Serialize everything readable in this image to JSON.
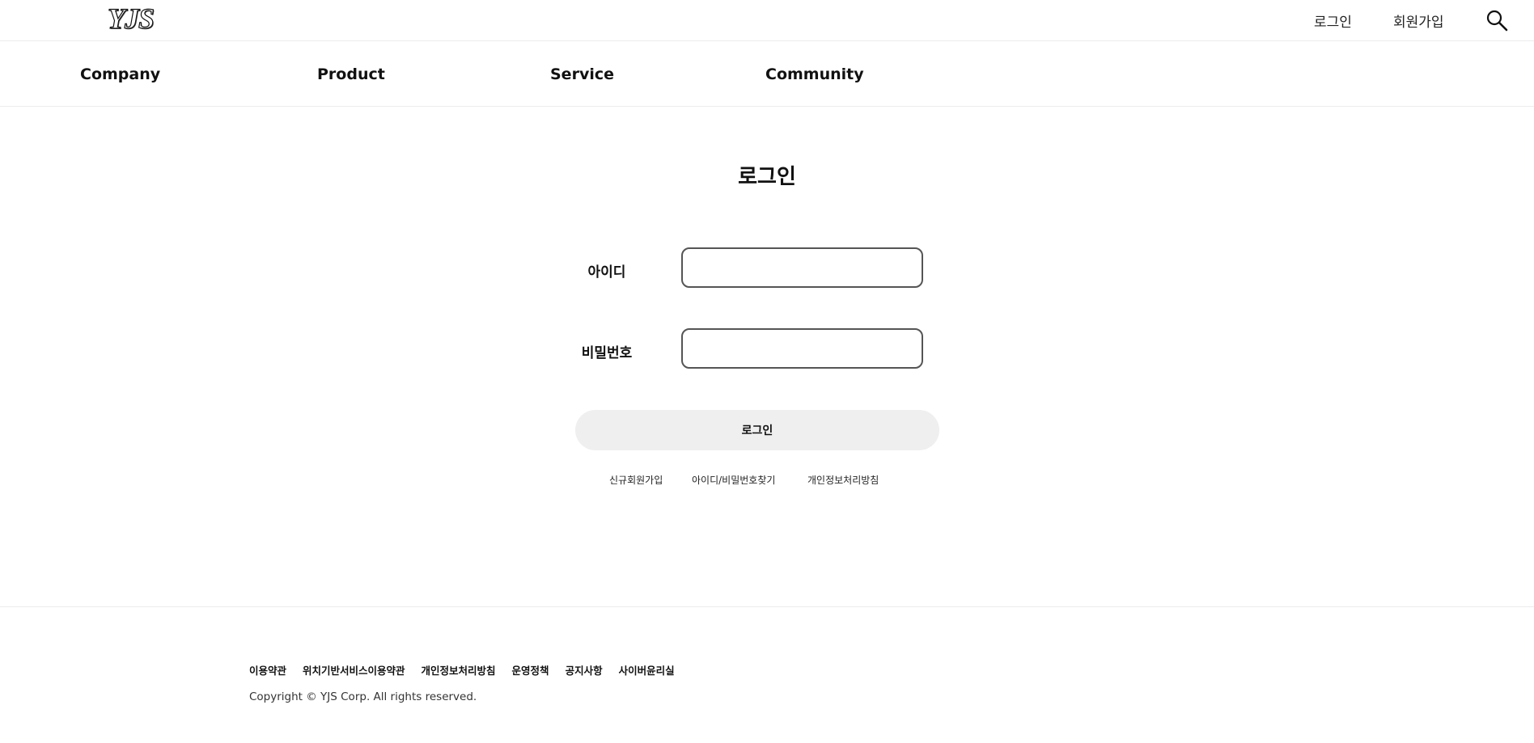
{
  "header": {
    "logo": "YJS",
    "util_links": {
      "login": "로그인",
      "join": "회원가입"
    },
    "search_icon": "search-icon"
  },
  "gnb": [
    "Company",
    "Product",
    "Service",
    "Community"
  ],
  "login": {
    "title": "로그인",
    "id_label": "아이디",
    "id_value": "",
    "password_label": "비밀번호",
    "password_value": "",
    "submit_label": "로그인",
    "links": [
      "신규회원가입",
      "아이디/비밀번호찾기",
      "개인정보처리방침"
    ]
  },
  "footer": {
    "links": [
      "이용약관",
      "위치기반서비스이용약관",
      "개인정보처리방침",
      "운영정책",
      "공지사항",
      "사이버윤리실"
    ],
    "copyright": "Copyright © YJS Corp. All rights reserved."
  },
  "colors": {
    "button_bg": "#efefef",
    "input_border": "#555555",
    "divider": "#ececec"
  }
}
